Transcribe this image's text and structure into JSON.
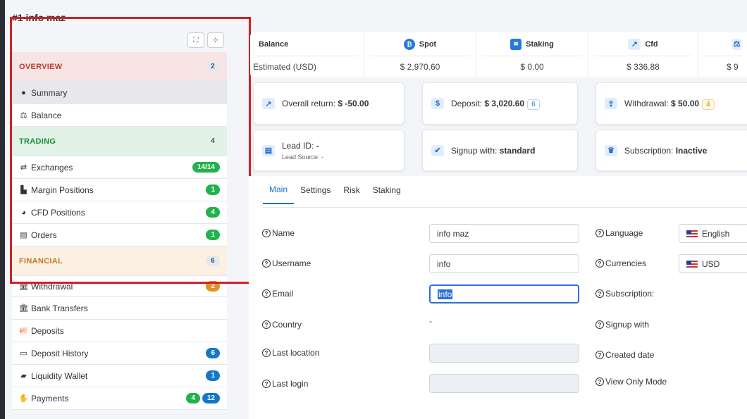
{
  "page": {
    "title": "#1 info maz"
  },
  "sidebar": {
    "sections": {
      "overview": {
        "label": "OVERVIEW",
        "count": "2"
      },
      "trading": {
        "label": "TRADING",
        "count": "4"
      },
      "financial": {
        "label": "FINANCIAL",
        "count": "6"
      }
    },
    "items": {
      "summary": {
        "label": "Summary",
        "icon": "user-circle-icon"
      },
      "balance": {
        "label": "Balance",
        "icon": "scale-icon"
      },
      "exchanges": {
        "label": "Exchanges",
        "icon": "exchange-arrows-icon",
        "badge": "14/14"
      },
      "margin": {
        "label": "Margin Positions",
        "icon": "chart-icon",
        "badge": "1"
      },
      "cfd": {
        "label": "CFD Positions",
        "icon": "pie-chart-icon",
        "badge": "4"
      },
      "orders": {
        "label": "Orders",
        "icon": "list-icon",
        "badge": "1"
      },
      "withdrawal": {
        "label": "Withdrawal",
        "icon": "bank-icon",
        "badge": "2"
      },
      "bank_transfers": {
        "label": "Bank Transfers",
        "icon": "bank-icon"
      },
      "deposits": {
        "label": "Deposits",
        "icon": "piggy-bank-icon"
      },
      "deposit_history": {
        "label": "Deposit History",
        "icon": "card-icon",
        "badge": "6"
      },
      "liquidity_wallet": {
        "label": "Liquidity Wallet",
        "icon": "wallet-icon",
        "badge": "1"
      },
      "payments": {
        "label": "Payments",
        "icon": "hand-money-icon",
        "badge_a": "4",
        "badge_b": "12"
      }
    }
  },
  "balance": {
    "header_label": "Balance",
    "row_label": "Estimated (USD)",
    "columns": [
      {
        "name": "Spot",
        "value": "$ 2,970.60"
      },
      {
        "name": "Staking",
        "value": "$ 0.00"
      },
      {
        "name": "Cfd",
        "value": "$ 336.88"
      },
      {
        "name": "",
        "value": "$ 9"
      }
    ]
  },
  "cards": {
    "overall_return": {
      "label": "Overall return:",
      "value": "$ -50.00"
    },
    "deposit": {
      "label": "Deposit:",
      "value": "$ 3,020.60",
      "tag": "6"
    },
    "withdrawal": {
      "label": "Withdrawal:",
      "value": "$ 50.00",
      "tag": "4"
    },
    "lead": {
      "label": "Lead ID:",
      "value": "-",
      "source": "Lead Source: -"
    },
    "signup": {
      "label": "Signup with:",
      "value": "standard"
    },
    "subscription": {
      "label": "Subscription:",
      "value": "Inactive"
    }
  },
  "tabs": [
    "Main",
    "Settings",
    "Risk",
    "Staking"
  ],
  "form": {
    "name": {
      "label": "Name",
      "value": "info maz"
    },
    "username": {
      "label": "Username",
      "value": "info"
    },
    "email": {
      "label": "Email",
      "value": "info"
    },
    "country": {
      "label": "Country",
      "value": "-"
    },
    "last_location": {
      "label": "Last location"
    },
    "last_login": {
      "label": "Last login"
    },
    "language": {
      "label": "Language",
      "value": "English"
    },
    "currencies": {
      "label": "Currencies",
      "value": "USD"
    },
    "subscription": {
      "label": "Subscription:"
    },
    "signup_with": {
      "label": "Signup with"
    },
    "created_date": {
      "label": "Created date"
    },
    "view_only": {
      "label": "View Only Mode"
    }
  }
}
